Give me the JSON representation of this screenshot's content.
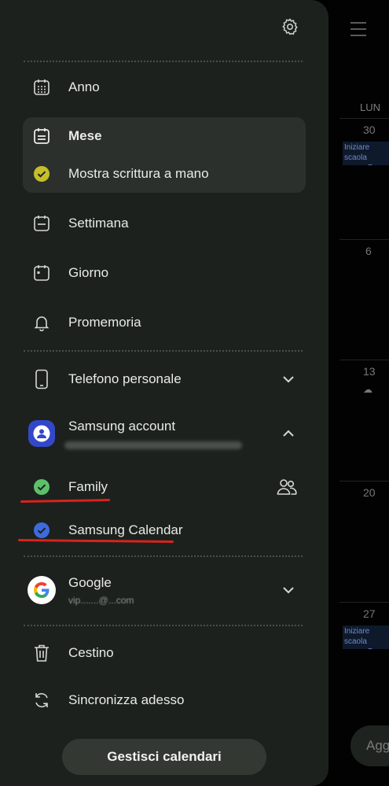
{
  "background": {
    "weekday": "LUN",
    "day_numbers": [
      "30",
      "6",
      "13",
      "20",
      "27"
    ],
    "event_text": "Iniziare scaola nuova B",
    "add_button_label": "Agg"
  },
  "drawer": {
    "views": [
      {
        "label": "Anno",
        "icon": "calendar-year-icon"
      },
      {
        "label": "Mese",
        "icon": "calendar-month-icon"
      },
      {
        "label": "Mostra scrittura a mano",
        "icon": "check-circle-icon"
      },
      {
        "label": "Settimana",
        "icon": "calendar-week-icon"
      },
      {
        "label": "Giorno",
        "icon": "calendar-day-icon"
      },
      {
        "label": "Promemoria",
        "icon": "bell-icon"
      }
    ],
    "accounts": {
      "phone": {
        "label": "Telefono personale"
      },
      "samsung": {
        "label": "Samsung account",
        "calendars": [
          {
            "label": "Family",
            "color": "#5cc06b"
          },
          {
            "label": "Samsung Calendar",
            "color": "#3d6bdc"
          }
        ]
      },
      "google": {
        "label": "Google",
        "email": "vip.......@...com"
      }
    },
    "trash_label": "Cestino",
    "sync_label": "Sincronizza adesso",
    "manage_button": "Gestisci calendari"
  },
  "colors": {
    "drawer_bg": "#1c211e",
    "selected_bg": "#2b302c",
    "handwriting_check": "#c5bd2b",
    "annotation_red": "#d8231c"
  }
}
